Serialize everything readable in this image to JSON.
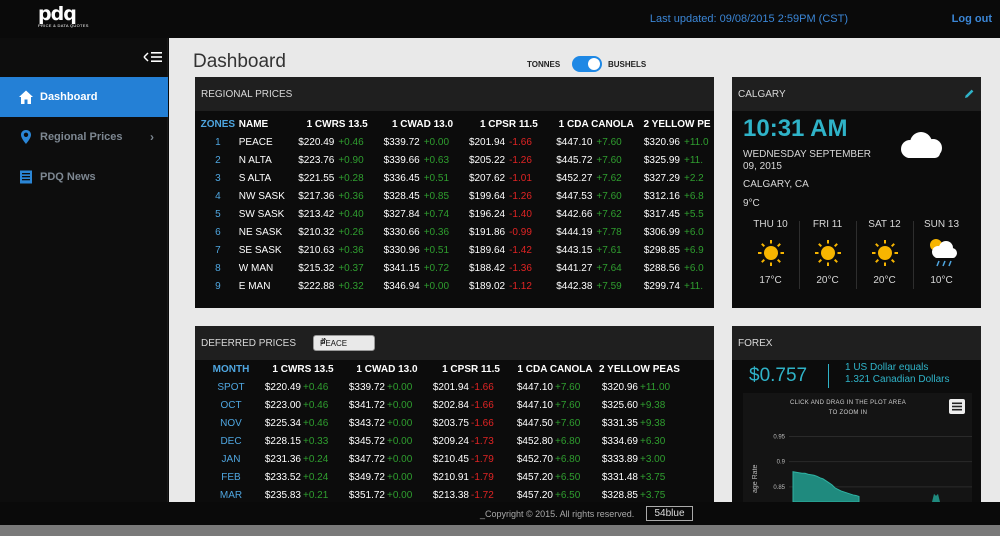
{
  "header": {
    "logo_top": "pdq",
    "logo_sub": "PRICE & DATA QUOTES",
    "last_updated": "Last updated: 09/08/2015 2:59PM (CST)",
    "logout": "Log out"
  },
  "sidebar": {
    "collapse_icon": "collapse-menu-icon",
    "items": [
      {
        "label": "Dashboard",
        "icon": "home-icon",
        "active": true
      },
      {
        "label": "Regional Prices",
        "icon": "location-pin-icon",
        "active": false
      },
      {
        "label": "PDQ News",
        "icon": "news-icon",
        "active": false
      }
    ]
  },
  "main": {
    "title": "Dashboard",
    "toggle": {
      "left": "TONNES",
      "right": "BUSHELS",
      "selected": "BUSHELS"
    }
  },
  "regional": {
    "title": "REGIONAL PRICES",
    "headers": [
      "ZONES",
      "NAME",
      "1 CWRS 13.5",
      "1 CWAD 13.0",
      "1 CPSR 11.5",
      "1 CDA CANOLA",
      "2 YELLOW PE"
    ],
    "rows": [
      {
        "zone": "1",
        "name": "PEACE",
        "c": [
          [
            "$220.49",
            "+0.46",
            "up"
          ],
          [
            "$339.72",
            "+0.00",
            "up"
          ],
          [
            "$201.94",
            "-1.66",
            "dn"
          ],
          [
            "$447.10",
            "+7.60",
            "up"
          ],
          [
            "$320.96",
            "+11.0",
            "up"
          ]
        ]
      },
      {
        "zone": "2",
        "name": "N ALTA",
        "c": [
          [
            "$223.76",
            "+0.90",
            "up"
          ],
          [
            "$339.66",
            "+0.63",
            "up"
          ],
          [
            "$205.22",
            "-1.26",
            "dn"
          ],
          [
            "$445.72",
            "+7.60",
            "up"
          ],
          [
            "$325.99",
            "+11.",
            "up"
          ]
        ]
      },
      {
        "zone": "3",
        "name": "S ALTA",
        "c": [
          [
            "$221.55",
            "+0.28",
            "up"
          ],
          [
            "$336.45",
            "+0.51",
            "up"
          ],
          [
            "$207.62",
            "-1.01",
            "dn"
          ],
          [
            "$452.27",
            "+7.62",
            "up"
          ],
          [
            "$327.29",
            "+2.2",
            "up"
          ]
        ]
      },
      {
        "zone": "4",
        "name": "NW SASK",
        "c": [
          [
            "$217.36",
            "+0.36",
            "up"
          ],
          [
            "$328.45",
            "+0.85",
            "up"
          ],
          [
            "$199.64",
            "-1.26",
            "dn"
          ],
          [
            "$447.53",
            "+7.60",
            "up"
          ],
          [
            "$312.16",
            "+6.8",
            "up"
          ]
        ]
      },
      {
        "zone": "5",
        "name": "SW SASK",
        "c": [
          [
            "$213.42",
            "+0.40",
            "up"
          ],
          [
            "$327.84",
            "+0.74",
            "up"
          ],
          [
            "$196.24",
            "-1.40",
            "dn"
          ],
          [
            "$442.66",
            "+7.62",
            "up"
          ],
          [
            "$317.45",
            "+5.5",
            "up"
          ]
        ]
      },
      {
        "zone": "6",
        "name": "NE SASK",
        "c": [
          [
            "$210.32",
            "+0.26",
            "up"
          ],
          [
            "$330.66",
            "+0.36",
            "up"
          ],
          [
            "$191.86",
            "-0.99",
            "dn"
          ],
          [
            "$444.19",
            "+7.78",
            "up"
          ],
          [
            "$306.99",
            "+6.0",
            "up"
          ]
        ]
      },
      {
        "zone": "7",
        "name": "SE SASK",
        "c": [
          [
            "$210.63",
            "+0.36",
            "up"
          ],
          [
            "$330.96",
            "+0.51",
            "up"
          ],
          [
            "$189.64",
            "-1.42",
            "dn"
          ],
          [
            "$443.15",
            "+7.61",
            "up"
          ],
          [
            "$298.85",
            "+6.9",
            "up"
          ]
        ]
      },
      {
        "zone": "8",
        "name": "W MAN",
        "c": [
          [
            "$215.32",
            "+0.37",
            "up"
          ],
          [
            "$341.15",
            "+0.72",
            "up"
          ],
          [
            "$188.42",
            "-1.36",
            "dn"
          ],
          [
            "$441.27",
            "+7.64",
            "up"
          ],
          [
            "$288.56",
            "+6.0",
            "up"
          ]
        ]
      },
      {
        "zone": "9",
        "name": "E MAN",
        "c": [
          [
            "$222.88",
            "+0.32",
            "up"
          ],
          [
            "$346.94",
            "+0.00",
            "up"
          ],
          [
            "$189.02",
            "-1.12",
            "dn"
          ],
          [
            "$442.38",
            "+7.59",
            "up"
          ],
          [
            "$299.74",
            "+11.",
            "up"
          ]
        ]
      }
    ]
  },
  "deferred": {
    "title": "DEFERRED PRICES",
    "select_value": "PEACE",
    "headers": [
      "MONTH",
      "1 CWRS 13.5",
      "1 CWAD 13.0",
      "1 CPSR 11.5",
      "1 CDA CANOLA",
      "2 YELLOW PEAS"
    ],
    "rows": [
      {
        "month": "SPOT",
        "c": [
          [
            "$220.49",
            "+0.46",
            "up"
          ],
          [
            "$339.72",
            "+0.00",
            "up"
          ],
          [
            "$201.94",
            "-1.66",
            "dn"
          ],
          [
            "$447.10",
            "+7.60",
            "up"
          ],
          [
            "$320.96",
            "+11.00",
            "up"
          ]
        ]
      },
      {
        "month": "OCT",
        "c": [
          [
            "$223.00",
            "+0.46",
            "up"
          ],
          [
            "$341.72",
            "+0.00",
            "up"
          ],
          [
            "$202.84",
            "-1.66",
            "dn"
          ],
          [
            "$447.10",
            "+7.60",
            "up"
          ],
          [
            "$325.60",
            "+9.38",
            "up"
          ]
        ]
      },
      {
        "month": "NOV",
        "c": [
          [
            "$225.34",
            "+0.46",
            "up"
          ],
          [
            "$343.72",
            "+0.00",
            "up"
          ],
          [
            "$203.75",
            "-1.66",
            "dn"
          ],
          [
            "$447.50",
            "+7.60",
            "up"
          ],
          [
            "$331.35",
            "+9.38",
            "up"
          ]
        ]
      },
      {
        "month": "DEC",
        "c": [
          [
            "$228.15",
            "+0.33",
            "up"
          ],
          [
            "$345.72",
            "+0.00",
            "up"
          ],
          [
            "$209.24",
            "-1.73",
            "dn"
          ],
          [
            "$452.80",
            "+6.80",
            "up"
          ],
          [
            "$334.69",
            "+6.30",
            "up"
          ]
        ]
      },
      {
        "month": "JAN",
        "c": [
          [
            "$231.36",
            "+0.24",
            "up"
          ],
          [
            "$347.72",
            "+0.00",
            "up"
          ],
          [
            "$210.45",
            "-1.79",
            "dn"
          ],
          [
            "$452.70",
            "+6.80",
            "up"
          ],
          [
            "$333.89",
            "+3.00",
            "up"
          ]
        ]
      },
      {
        "month": "FEB",
        "c": [
          [
            "$233.52",
            "+0.24",
            "up"
          ],
          [
            "$349.72",
            "+0.00",
            "up"
          ],
          [
            "$210.91",
            "-1.79",
            "dn"
          ],
          [
            "$457.20",
            "+6.50",
            "up"
          ],
          [
            "$331.48",
            "+3.75",
            "up"
          ]
        ]
      },
      {
        "month": "MAR",
        "c": [
          [
            "$235.83",
            "+0.21",
            "up"
          ],
          [
            "$351.72",
            "+0.00",
            "up"
          ],
          [
            "$213.38",
            "-1.72",
            "dn"
          ],
          [
            "$457.20",
            "+6.50",
            "up"
          ],
          [
            "$328.85",
            "+3.75",
            "up"
          ]
        ]
      }
    ]
  },
  "calgary": {
    "title": "CALGARY",
    "time": "10:31 AM",
    "date": "WEDNESDAY SEPTEMBER 09, 2015",
    "location": "CALGARY, CA",
    "temp": "9°C",
    "current_icon": "cloudy-icon",
    "forecast": [
      {
        "day": "THU 10",
        "temp": "17°C",
        "icon": "sun-icon"
      },
      {
        "day": "FRI 11",
        "temp": "20°C",
        "icon": "sun-icon"
      },
      {
        "day": "SAT 12",
        "temp": "20°C",
        "icon": "sun-icon"
      },
      {
        "day": "SUN 13",
        "temp": "10°C",
        "icon": "rain-icon"
      }
    ]
  },
  "forex": {
    "title": "FOREX",
    "value": "$0.757",
    "line1": "1 US Dollar equals",
    "line2": "1.321 Canadian Dollars",
    "chart_hint": "CLICK AND DRAG IN THE PLOT AREA TO ZOOM IN",
    "colors": {
      "fill": "#1f8a7e",
      "line": "#2fb3a3"
    }
  },
  "chart_data": {
    "type": "area",
    "title": "",
    "ylabel": "age Rate",
    "yticks": [
      "0.95",
      "0.9",
      "0.85"
    ],
    "ylim": [
      0.82,
      0.97
    ],
    "values": [
      0.88,
      0.879,
      0.878,
      0.877,
      0.877,
      0.875,
      0.874,
      0.873,
      0.871,
      0.868,
      0.866,
      0.862,
      0.858,
      0.854,
      0.848,
      0.845,
      0.842,
      0.84,
      0.838,
      0.836,
      0.834,
      0.833,
      0.831
    ],
    "extra_bump": {
      "x_index": 33,
      "value": 0.836
    }
  },
  "footer": {
    "copyright": "_Copyright © 2015. All rights reserved.",
    "brand": "54blue"
  }
}
